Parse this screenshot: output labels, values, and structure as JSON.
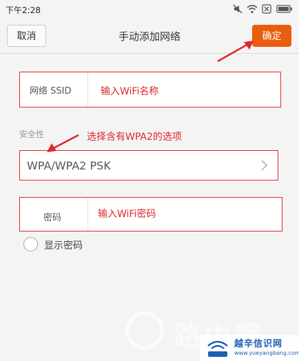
{
  "status_bar": {
    "time": "下午2:28",
    "icons": [
      "mute-icon",
      "wifi-icon",
      "sim-x-icon",
      "battery-icon"
    ]
  },
  "header": {
    "cancel_label": "取消",
    "title": "手动添加网络",
    "ok_label": "确定"
  },
  "form": {
    "ssid_label": "网络 SSID",
    "security_caption": "安全性",
    "security_value": "WPA/WPA2 PSK",
    "password_label": "密码",
    "show_password_label": "显示密码"
  },
  "annotations": {
    "ssid_note": "输入WiFi名称",
    "security_note": "选择含有WPA2的选项",
    "password_note": "输入WiFi密码"
  },
  "watermark": {
    "brand_title": "路由器",
    "site_name": "越辛信识网",
    "url": "www.yueyangbang.com"
  },
  "colors": {
    "accent": "#e85d0e",
    "annotation_red": "#e0262c",
    "background": "#f4f4f4"
  }
}
